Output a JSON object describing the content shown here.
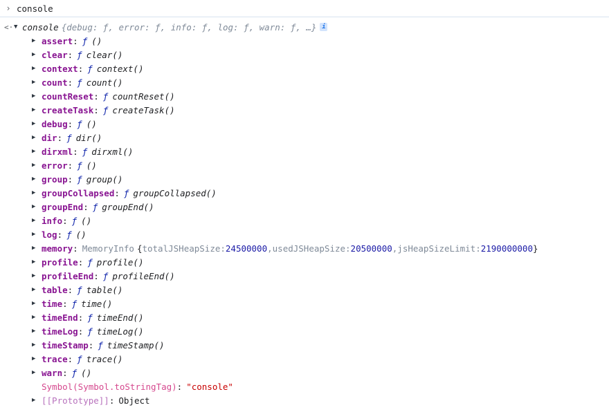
{
  "input": {
    "prompt_icon": "chevron-right-icon",
    "command": "console"
  },
  "result": {
    "return_icon": "return-arrow-icon",
    "object_name": "console",
    "preview": "{debug: ƒ, error: ƒ, info: ƒ, log: ƒ, warn: ƒ, …}",
    "info_badge": "i"
  },
  "function_marker": "ƒ",
  "properties": [
    {
      "key": "assert",
      "value": "()"
    },
    {
      "key": "clear",
      "value": "clear()"
    },
    {
      "key": "context",
      "value": "context()"
    },
    {
      "key": "count",
      "value": "count()"
    },
    {
      "key": "countReset",
      "value": "countReset()"
    },
    {
      "key": "createTask",
      "value": "createTask()"
    },
    {
      "key": "debug",
      "value": "()"
    },
    {
      "key": "dir",
      "value": "dir()"
    },
    {
      "key": "dirxml",
      "value": "dirxml()"
    },
    {
      "key": "error",
      "value": "()"
    },
    {
      "key": "group",
      "value": "group()"
    },
    {
      "key": "groupCollapsed",
      "value": "groupCollapsed()"
    },
    {
      "key": "groupEnd",
      "value": "groupEnd()"
    },
    {
      "key": "info",
      "value": "()"
    },
    {
      "key": "log",
      "value": "()"
    }
  ],
  "memory": {
    "key": "memory",
    "class_name": "MemoryInfo",
    "open_brace": "{",
    "fields": [
      {
        "key": "totalJSHeapSize",
        "value": "24500000"
      },
      {
        "key": "usedJSHeapSize",
        "value": "20500000"
      },
      {
        "key": "jsHeapSizeLimit",
        "value": "2190000000"
      }
    ],
    "close_brace": "}"
  },
  "properties_after": [
    {
      "key": "profile",
      "value": "profile()"
    },
    {
      "key": "profileEnd",
      "value": "profileEnd()"
    },
    {
      "key": "table",
      "value": "table()"
    },
    {
      "key": "time",
      "value": "time()"
    },
    {
      "key": "timeEnd",
      "value": "timeEnd()"
    },
    {
      "key": "timeLog",
      "value": "timeLog()"
    },
    {
      "key": "timeStamp",
      "value": "timeStamp()"
    },
    {
      "key": "trace",
      "value": "trace()"
    },
    {
      "key": "warn",
      "value": "()"
    }
  ],
  "symbol_entry": {
    "key": "Symbol(Symbol.toStringTag)",
    "value": "\"console\""
  },
  "prototype_entry": {
    "key": "[[Prototype]]",
    "value": "Object"
  }
}
